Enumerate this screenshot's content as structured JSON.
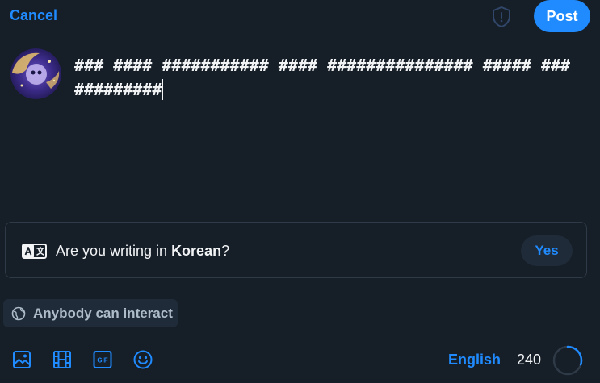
{
  "header": {
    "cancel_label": "Cancel",
    "post_label": "Post",
    "shield_icon": "shield-exclamation-icon"
  },
  "composer": {
    "text": "### #### ########### #### ############### ##### ############"
  },
  "language_suggestion": {
    "question_prefix": "Are you writing in ",
    "language": "Korean",
    "question_suffix": "?",
    "yes_label": "Yes",
    "icon": "translate-icon"
  },
  "interaction": {
    "label": "Anybody can interact",
    "icon": "globe-icon"
  },
  "toolbar": {
    "tools": [
      "image-icon",
      "video-icon",
      "gif-icon",
      "emoji-icon"
    ],
    "gif_text": "GIF",
    "language_label": "English",
    "char_remaining": "240",
    "char_progress": 0.3
  },
  "colors": {
    "accent": "#208bfe",
    "background": "#161e27",
    "border": "#2e3a47",
    "pill_bg": "#1f2b38",
    "text": "#f1f3f5",
    "muted_text": "#aebbc9"
  }
}
